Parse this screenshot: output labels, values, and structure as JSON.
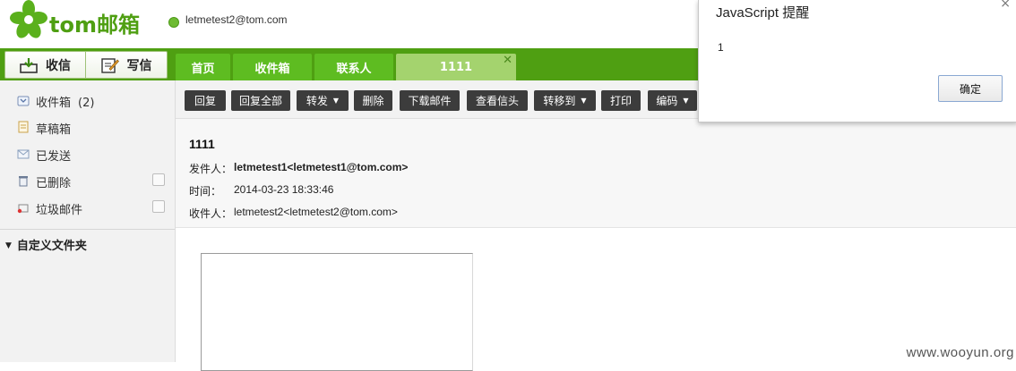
{
  "header": {
    "logo_text": "tom邮箱",
    "user_email": "letmetest2@tom.com"
  },
  "actions": {
    "receive_label": "收信",
    "write_label": "写信"
  },
  "tabs": [
    {
      "label": "首页"
    },
    {
      "label": "收件箱"
    },
    {
      "label": "联系人"
    },
    {
      "label": "1111",
      "active": true
    }
  ],
  "sidebar": {
    "folders": [
      {
        "label": "收件箱",
        "count": "(2)"
      },
      {
        "label": "草稿箱"
      },
      {
        "label": "已发送"
      },
      {
        "label": "已删除"
      },
      {
        "label": "垃圾邮件"
      }
    ],
    "custom_folder_label": "自定义文件夹"
  },
  "toolbar": {
    "buttons": [
      {
        "label": "回复"
      },
      {
        "label": "回复全部"
      },
      {
        "label": "转发",
        "dropdown": true
      },
      {
        "label": "删除"
      },
      {
        "label": "下载邮件"
      },
      {
        "label": "查看信头"
      },
      {
        "label": "转移到",
        "dropdown": true
      },
      {
        "label": "打印"
      },
      {
        "label": "编码",
        "dropdown": true
      }
    ]
  },
  "mail": {
    "subject": "1111",
    "from_label": "发件人：",
    "from_value": "letmetest1<letmetest1@tom.com>",
    "time_label": "时间：",
    "time_value": "2014-03-23 18:33:46",
    "to_label": "收件人：",
    "to_value": "letmetest2<letmetest2@tom.com>"
  },
  "alert": {
    "title": "JavaScript 提醒",
    "message": "1",
    "ok_label": "确定",
    "close_label": "×"
  },
  "watermark": "www.wooyun.org",
  "colors": {
    "brand_green": "#4f9f12",
    "tab_green": "#5ebc21",
    "active_tab": "#a4d36e",
    "toolbar_button": "#3c3c3c"
  }
}
